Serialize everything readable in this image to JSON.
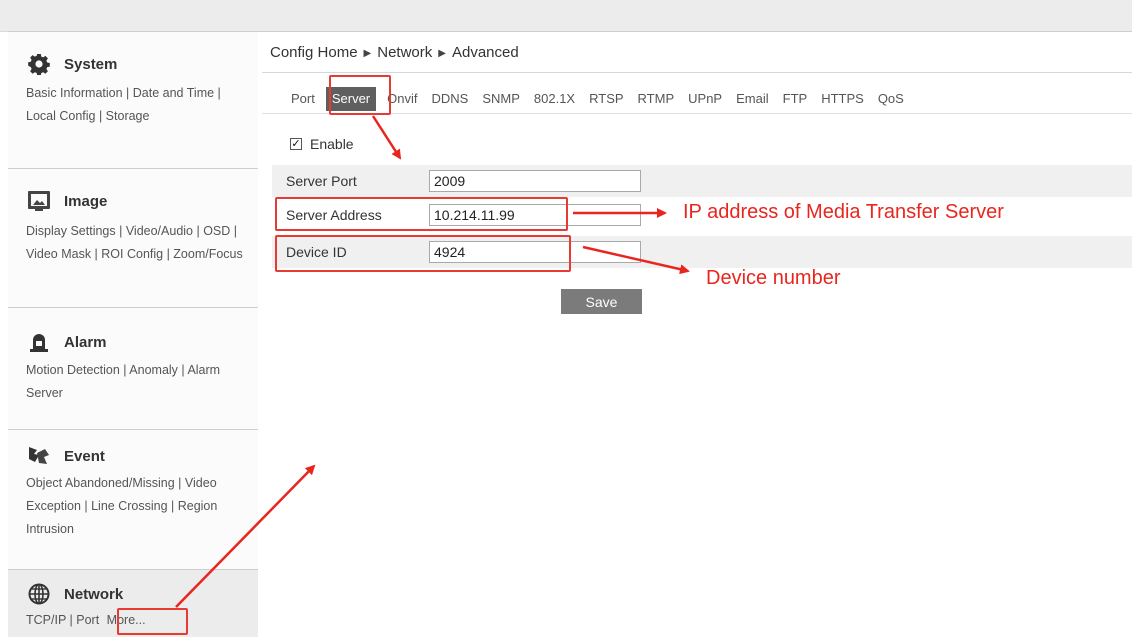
{
  "sidebar": {
    "sections": [
      {
        "title": "System",
        "icon": "gear-icon",
        "links": "Basic Information | Date and Time | Local Config | Storage"
      },
      {
        "title": "Image",
        "icon": "image-icon",
        "links": "Display Settings | Video/Audio | OSD | Video Mask | ROI Config | Zoom/Focus"
      },
      {
        "title": "Alarm",
        "icon": "alarm-icon",
        "links": "Motion Detection | Anomaly | Alarm Server"
      },
      {
        "title": "Event",
        "icon": "event-icon",
        "links": "Object Abandoned/Missing | Video Exception | Line Crossing | Region Intrusion"
      },
      {
        "title": "Network",
        "icon": "globe-icon",
        "links_prefix": "TCP/IP | Port",
        "more": "More..."
      }
    ]
  },
  "breadcrumb": {
    "home": "Config Home",
    "level1": "Network",
    "level2": "Advanced"
  },
  "tabs": [
    "Port",
    "Server",
    "Onvif",
    "DDNS",
    "SNMP",
    "802.1X",
    "RTSP",
    "RTMP",
    "UPnP",
    "Email",
    "FTP",
    "HTTPS",
    "QoS"
  ],
  "active_tab": "Server",
  "form": {
    "enable_label": "Enable",
    "enable_checked": true,
    "server_port_label": "Server Port",
    "server_port_value": "2009",
    "server_address_label": "Server Address",
    "server_address_value": "10.214.11.99",
    "device_id_label": "Device ID",
    "device_id_value": "4924",
    "save_label": "Save"
  },
  "annotations": {
    "ip_note": "IP address of Media Transfer Server",
    "device_note": "Device number",
    "color": "#e8261f"
  },
  "colors": {
    "active_tab_bg": "#5f5f5f",
    "save_bg": "#7b7b7b",
    "row_shade": "#f0f0f0"
  }
}
